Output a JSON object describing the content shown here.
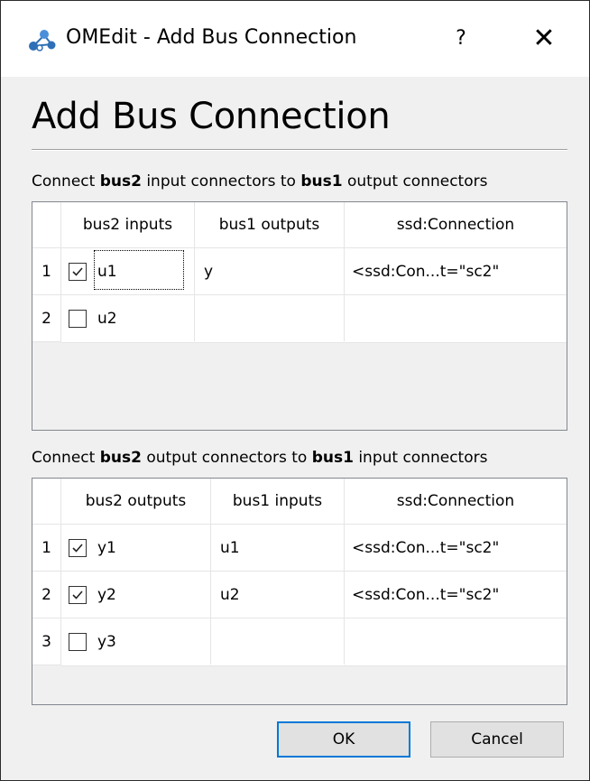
{
  "window": {
    "title": "OMEdit - Add Bus Connection",
    "help_glyph": "?",
    "close_glyph": "✕"
  },
  "dialog": {
    "heading": "Add Bus Connection",
    "section1": {
      "caption_parts": [
        "Connect ",
        "bus2",
        " input connectors to ",
        "bus1",
        " output connectors"
      ],
      "columns": [
        "bus2 inputs",
        "bus1 outputs",
        "ssd:Connection"
      ],
      "rows": [
        {
          "num": "1",
          "checked": true,
          "name": "u1",
          "target": "y",
          "connection": "<ssd:Con...t=\"sc2\""
        },
        {
          "num": "2",
          "checked": false,
          "name": "u2",
          "target": "",
          "connection": ""
        }
      ]
    },
    "section2": {
      "caption_parts": [
        "Connect ",
        "bus2",
        " output connectors to ",
        "bus1",
        " input connectors"
      ],
      "columns": [
        "bus2 outputs",
        "bus1 inputs",
        "ssd:Connection"
      ],
      "rows": [
        {
          "num": "1",
          "checked": true,
          "name": "y1",
          "target": "u1",
          "connection": "<ssd:Con...t=\"sc2\""
        },
        {
          "num": "2",
          "checked": true,
          "name": "y2",
          "target": "u2",
          "connection": "<ssd:Con...t=\"sc2\""
        },
        {
          "num": "3",
          "checked": false,
          "name": "y3",
          "target": "",
          "connection": ""
        }
      ]
    },
    "buttons": {
      "ok": "OK",
      "cancel": "Cancel"
    }
  },
  "icons": {
    "app": "omedit-network-icon",
    "check": "checkmark-icon"
  },
  "colors": {
    "default_button_border": "#0078d7",
    "window_bg": "#f0f0f0",
    "grid_line": "#e5e5e5"
  }
}
